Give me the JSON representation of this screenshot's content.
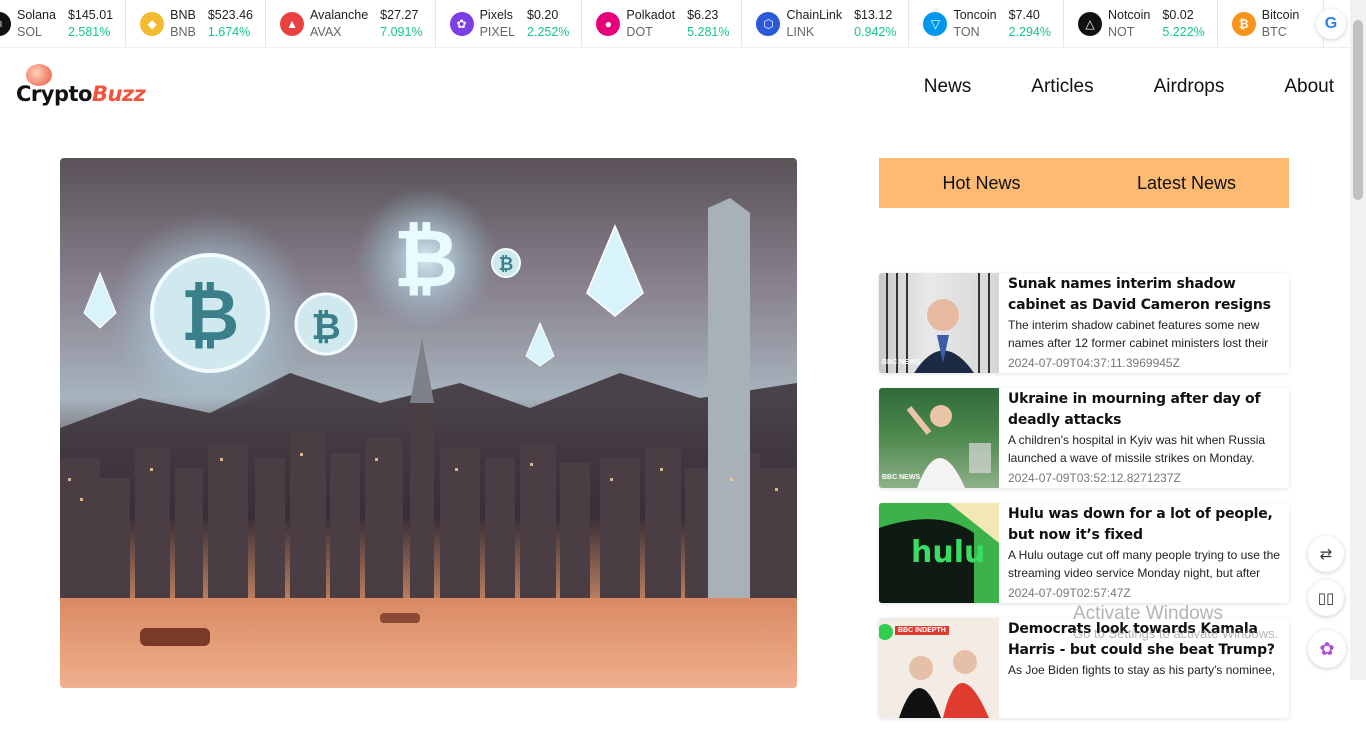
{
  "ticker": {
    "coins": [
      {
        "name": "Solana",
        "symbol": "SOL",
        "price": "$145.01",
        "change": "2.581%",
        "color": "#111111",
        "icon": "solana-icon"
      },
      {
        "name": "BNB",
        "symbol": "BNB",
        "price": "$523.46",
        "change": "1.674%",
        "color": "#f3ba2f",
        "icon": "bnb-icon"
      },
      {
        "name": "Avalanche",
        "symbol": "AVAX",
        "price": "$27.27",
        "change": "7.091%",
        "color": "#e84142",
        "icon": "avalanche-icon"
      },
      {
        "name": "Pixels",
        "symbol": "PIXEL",
        "price": "$0.20",
        "change": "2.252%",
        "color": "#7b3fe4",
        "icon": "pixels-icon"
      },
      {
        "name": "Polkadot",
        "symbol": "DOT",
        "price": "$6.23",
        "change": "5.281%",
        "color": "#e6007a",
        "icon": "polkadot-icon"
      },
      {
        "name": "ChainLink",
        "symbol": "LINK",
        "price": "$13.12",
        "change": "0.942%",
        "color": "#2a5ada",
        "icon": "chainlink-icon"
      },
      {
        "name": "Toncoin",
        "symbol": "TON",
        "price": "$7.40",
        "change": "2.294%",
        "color": "#0098ea",
        "icon": "toncoin-icon"
      },
      {
        "name": "Notcoin",
        "symbol": "NOT",
        "price": "$0.02",
        "change": "5.222%",
        "color": "#111111",
        "icon": "notcoin-icon"
      },
      {
        "name": "Bitcoin",
        "symbol": "BTC",
        "price": "",
        "change": "",
        "color": "#f7931a",
        "icon": "bitcoin-icon"
      }
    ],
    "change_color": "#16c784"
  },
  "header": {
    "logo_text_1": "Crypto",
    "logo_text_2": "Buzz",
    "nav": [
      "News",
      "Articles",
      "Airdrops",
      "About"
    ]
  },
  "sidebar": {
    "tabs": [
      "Hot News",
      "Latest News"
    ],
    "tab_color": "#fcba72"
  },
  "news": [
    {
      "title": "Sunak names interim shadow cabinet as David Cameron resigns",
      "description": "The interim shadow cabinet features some new names after 12 former cabinet ministers lost their",
      "date": "2024-07-09T04:37:11.3969945Z"
    },
    {
      "title": "Ukraine in mourning after day of deadly attacks",
      "description": "A children's hospital in Kyiv was hit when Russia launched a wave of missile strikes on Monday.",
      "date": "2024-07-09T03:52:12.8271237Z"
    },
    {
      "title": "Hulu was down for a lot of people, but now it’s fixed",
      "description": "A Hulu outage cut off many people trying to use the streaming video service Monday night, but after",
      "date": "2024-07-09T02:57:47Z"
    },
    {
      "title": "Democrats look towards Kamala Harris - but could she beat Trump?",
      "description": "As Joe Biden fights to stay as his party's nominee,",
      "date": ""
    }
  ],
  "thumbs": {
    "bbc_label": "BBC NEWS",
    "hulu_label": "hulu",
    "indepth_label": "BBC INDEPTH"
  },
  "watermark": {
    "line1": "Activate Windows",
    "line2": "Go to Settings to activate Windows."
  }
}
